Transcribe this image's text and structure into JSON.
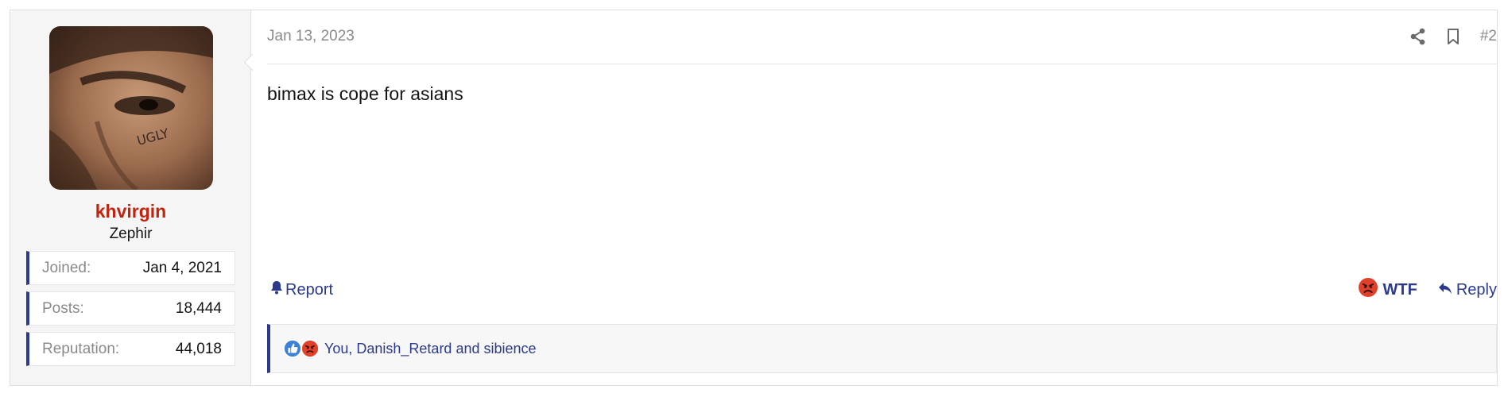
{
  "user": {
    "username": "khvirgin",
    "title": "Zephir",
    "stats": [
      {
        "label": "Joined:",
        "value": "Jan 4, 2021"
      },
      {
        "label": "Posts:",
        "value": "18,444"
      },
      {
        "label": "Reputation:",
        "value": "44,018"
      }
    ],
    "avatar_icon": "avatar-photo"
  },
  "post": {
    "date": "Jan 13, 2023",
    "number": "#2",
    "body": "bimax is cope for asians"
  },
  "actions": {
    "report_label": "Report",
    "reaction_label": "WTF",
    "reply_label": "Reply",
    "share_icon": "share-icon",
    "bookmark_icon": "bookmark-icon"
  },
  "reactions": {
    "summary": "You, Danish_Retard and sibience",
    "icons": [
      "like-reaction-icon",
      "angry-reaction-icon"
    ]
  },
  "colors": {
    "username": "#c0230e",
    "accent": "#2b3a8c",
    "muted": "#8a8a8a"
  }
}
